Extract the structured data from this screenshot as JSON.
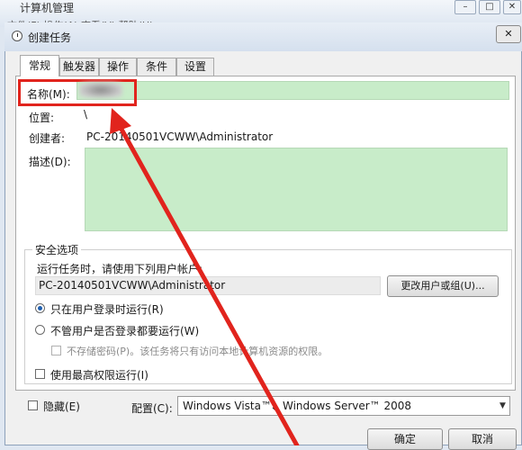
{
  "bg_window": {
    "title": "计算机管理",
    "menu": "文件(F)  操作(A)  查看(V)  帮助(H)",
    "controls": [
      "–",
      "□",
      "✕"
    ]
  },
  "dialog": {
    "title": "创建任务",
    "close": "✕"
  },
  "tabs": [
    "常规",
    "触发器",
    "操作",
    "条件",
    "设置"
  ],
  "general": {
    "name_label": "名称(M):",
    "name_value": "",
    "location_label": "位置:",
    "location_value": "\\",
    "author_label": "创建者:",
    "author_value": "PC-20140501VCWW\\Administrator",
    "description_label": "描述(D):",
    "description_value": ""
  },
  "security": {
    "legend": "安全选项",
    "run_as_label": "运行任务时，请使用下列用户帐户:",
    "account_value": "PC-20140501VCWW\\Administrator",
    "change_user_button": "更改用户或组(U)...",
    "radio_logged_on": "只在用户登录时运行(R)",
    "radio_whether_logged": "不管用户是否登录都要运行(W)",
    "no_store_password": "不存储密码(P)。该任务将只有访问本地计算机资源的权限。",
    "highest_privileges": "使用最高权限运行(I)"
  },
  "footer": {
    "hidden_label": "隐藏(E)",
    "config_label": "配置(C):",
    "config_value": "Windows Vista™、Windows Server™ 2008",
    "ok_button": "确定",
    "cancel_button": "取消"
  },
  "colors": {
    "annotation": "#e1241d",
    "field_highlight": "#c8ecc9"
  }
}
